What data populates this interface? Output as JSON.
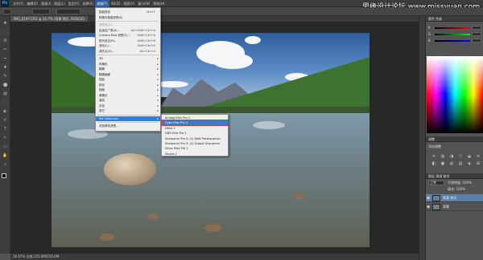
{
  "app": {
    "logo": "Ps"
  },
  "menubar": {
    "items": [
      "文件(F)",
      "编辑(E)",
      "图像(I)",
      "图层(L)",
      "类型(Y)",
      "选择(S)",
      "滤镜(T)",
      "3D(D)",
      "视图(V)",
      "窗口(W)",
      "帮助(H)"
    ],
    "active_index": 6
  },
  "watermark": "思缘设计论坛 www.missyuan.com",
  "document_tab": "IMG_0197.CR2 @ 16.7% (背景 拷贝, RGB/16)",
  "status_bar": "16.67%   文档:125.0M/250.0M",
  "filter_menu": {
    "items": [
      {
        "label": "智能锐化",
        "shortcut": "Ctrl+F"
      },
      {
        "label": "转换为智能滤镜(S)"
      },
      {
        "label": "滤镜库(G)...",
        "disabled": true
      },
      {
        "label": "自适应广角(A)...",
        "shortcut": "Alt+Shift+Ctrl+A"
      },
      {
        "label": "Camera Raw 滤镜(C)...",
        "shortcut": "Shift+Ctrl+A"
      },
      {
        "label": "镜头校正(R)...",
        "shortcut": "Shift+Ctrl+R"
      },
      {
        "label": "液化(L)...",
        "shortcut": "Shift+Ctrl+X"
      },
      {
        "label": "消失点(V)...",
        "shortcut": "Alt+Ctrl+V"
      },
      {
        "label": "3D"
      },
      {
        "label": "风格化"
      },
      {
        "label": "模糊"
      },
      {
        "label": "模糊画廊"
      },
      {
        "label": "扭曲"
      },
      {
        "label": "锐化"
      },
      {
        "label": "视频"
      },
      {
        "label": "像素化"
      },
      {
        "label": "渲染"
      },
      {
        "label": "杂色"
      },
      {
        "label": "其它"
      },
      {
        "label": "Nik Collection"
      },
      {
        "label": "浏览联机滤镜..."
      }
    ],
    "highlighted_index": 19
  },
  "nik_submenu": {
    "items": [
      "Analog Efex Pro 2",
      "Color Efex Pro 4",
      "Dfine 2",
      "HDR Efex Pro 2",
      "Sharpener Pro 3: (1) RAW Presharpener",
      "Sharpener Pro 3: (2) Output Sharpener",
      "Silver Efex Pro 2",
      "Viveza 2"
    ],
    "highlighted_index": 1
  },
  "right_panel": {
    "color_tabs": "颜色  色板",
    "sliders": [
      {
        "label": "R",
        "value": ""
      },
      {
        "label": "G",
        "value": ""
      },
      {
        "label": "B",
        "value": ""
      }
    ],
    "adjustments_title": "调整",
    "adjustments_subtitle": "添加调整",
    "layers_tabs": "图层  通道  路径",
    "layers_mode": "正常",
    "layers_opacity": "不透明度: 100%",
    "layers_fill": "填充: 100%",
    "layers": [
      {
        "name": "背景 拷贝",
        "selected": true
      },
      {
        "name": "背景",
        "selected": false
      }
    ]
  }
}
